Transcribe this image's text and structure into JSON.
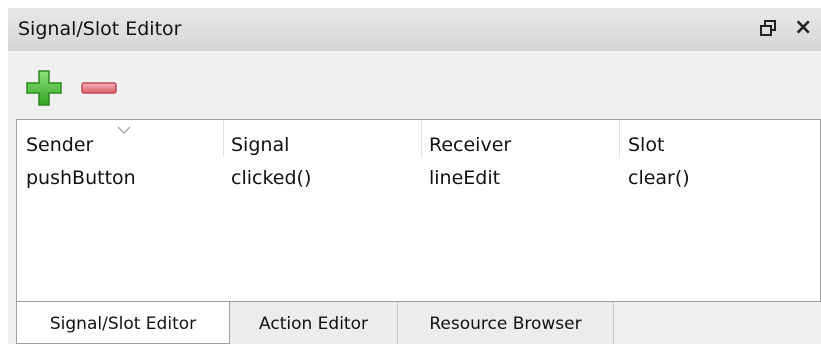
{
  "window": {
    "title": "Signal/Slot Editor"
  },
  "toolbar": {
    "add_icon": "plus-icon",
    "remove_icon": "minus-icon",
    "add_color": "#3fbf2e",
    "remove_color": "#e0707a"
  },
  "table": {
    "columns": [
      "Sender",
      "Signal",
      "Receiver",
      "Slot"
    ],
    "rows": [
      [
        "pushButton",
        "clicked()",
        "lineEdit",
        "clear()"
      ]
    ]
  },
  "tabs": [
    {
      "label": "Signal/Slot Editor",
      "active": true
    },
    {
      "label": "Action Editor",
      "active": false
    },
    {
      "label": "Resource Browser",
      "active": false
    }
  ]
}
